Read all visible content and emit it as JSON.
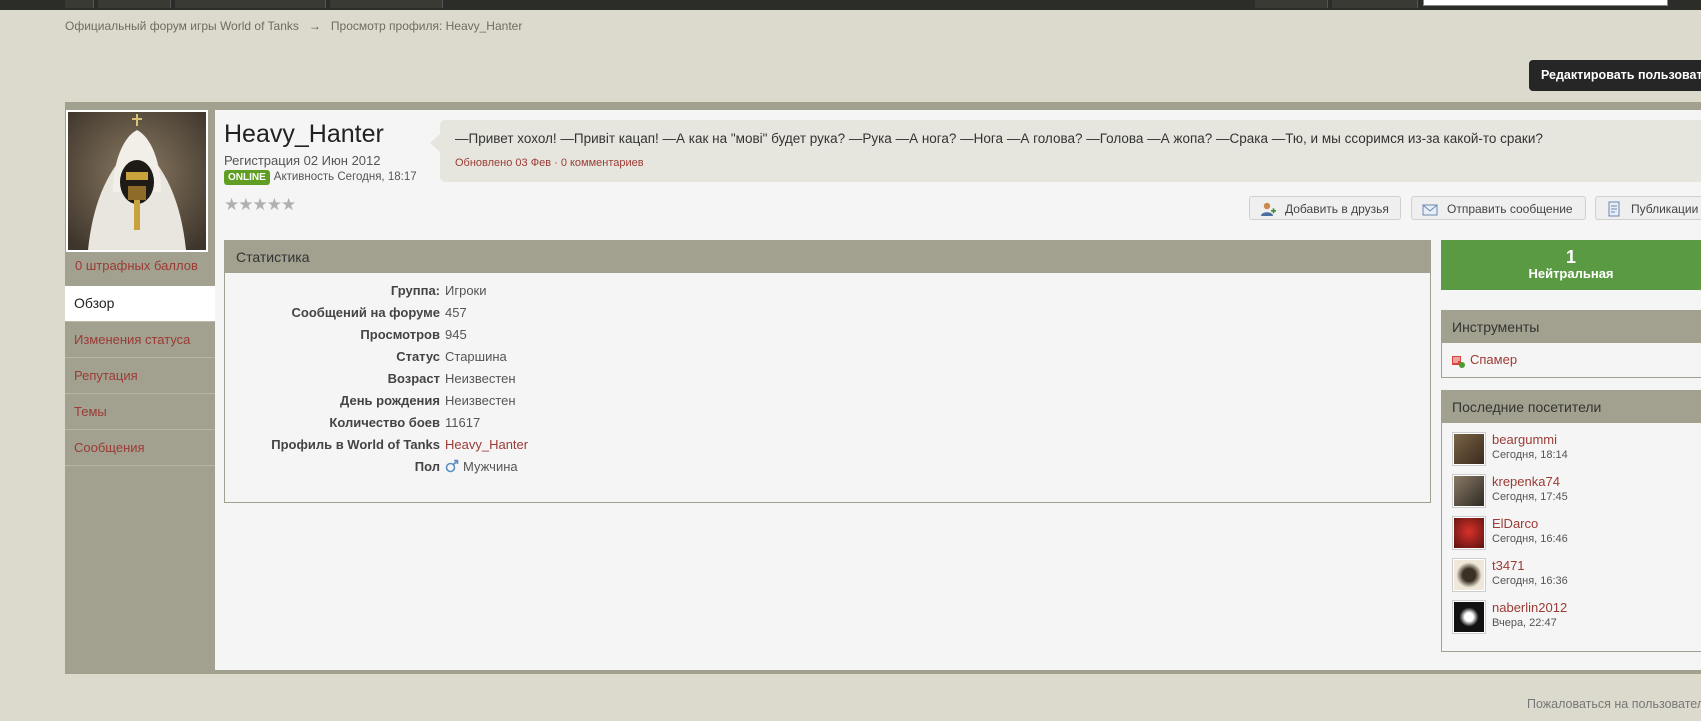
{
  "breadcrumb": {
    "home": "Официальный форум игры World of Tanks",
    "arrow": "→",
    "current": "Просмотр профиля: Heavy_Hanter"
  },
  "edit_button": "Редактировать пользователя",
  "profile": {
    "username": "Heavy_Hanter",
    "registered": "Регистрация 02 Июн 2012",
    "online_badge": "ONLINE",
    "activity": "Активность Сегодня, 18:17",
    "rating_stars": 0,
    "rating_max": 5
  },
  "sidebar": {
    "penalty": "0 штрафных баллов",
    "items": [
      {
        "label": "Обзор",
        "active": true
      },
      {
        "label": "Изменения статуса",
        "active": false
      },
      {
        "label": "Репутация",
        "active": false
      },
      {
        "label": "Темы",
        "active": false
      },
      {
        "label": "Сообщения",
        "active": false
      }
    ]
  },
  "status": {
    "text": "—Привет хохол! —Привіт кацап! —А как на \"мові\" будет рука? —Рука —А нога? —Нога —А голова? —Голова —А жопа? —Срака —Тю, и мы ссоримся из-за какой-то сраки?",
    "meta": "Обновлено 03 Фев · 0 комментариев"
  },
  "actions": {
    "add_friend": "Добавить в друзья",
    "send_message": "Отправить сообщение",
    "publications": "Публикации"
  },
  "stats": {
    "title": "Статистика",
    "rows": [
      {
        "key": "Группа:",
        "value": "Игроки"
      },
      {
        "key": "Сообщений на форуме",
        "value": "457"
      },
      {
        "key": "Просмотров",
        "value": "945"
      },
      {
        "key": "Статус",
        "value": "Старшина"
      },
      {
        "key": "Возраст",
        "value": "Неизвестен"
      },
      {
        "key": "День рождения",
        "value": "Неизвестен"
      },
      {
        "key": "Количество боев",
        "value": "11617"
      },
      {
        "key": "Профиль в World of Tanks",
        "value": "Heavy_Hanter"
      },
      {
        "key": "Пол",
        "value": "Мужчина"
      }
    ]
  },
  "reputation": {
    "value": "1",
    "label": "Нейтральная"
  },
  "tools": {
    "title": "Инструменты",
    "item": "Спамер"
  },
  "visitors": {
    "title": "Последние посетители",
    "items": [
      {
        "name": "beargummi",
        "time": "Сегодня, 18:14"
      },
      {
        "name": "krepenka74",
        "time": "Сегодня, 17:45"
      },
      {
        "name": "ElDarco",
        "time": "Сегодня, 16:46"
      },
      {
        "name": "t3471",
        "time": "Сегодня, 16:36"
      },
      {
        "name": "naberlin2012",
        "time": "Вчера, 22:47"
      }
    ]
  },
  "report_user": "Пожаловаться на пользователя",
  "colors": {
    "accent_link": "#9b3b35",
    "header_band": "#a2a08f",
    "reputation_green": "#5a9a43",
    "online_green": "#5f9e22"
  }
}
